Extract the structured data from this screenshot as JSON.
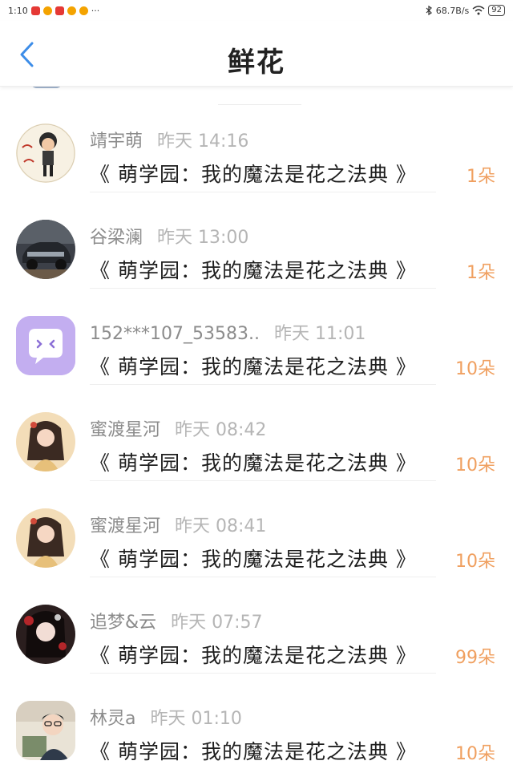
{
  "status_bar": {
    "time": "1:10",
    "dots": "···",
    "network_speed": "68.7B/s",
    "battery": "92"
  },
  "header": {
    "title": "鲜花",
    "back_icon": "chevron-left-icon"
  },
  "colors": {
    "accent_blue": "#3d8de8",
    "count_orange": "#f0a060",
    "time_gray": "#b5b5b5"
  },
  "items": [
    {
      "user": "靖宇萌",
      "time": "昨天 14:16",
      "book": "《 萌学园：我的魔法是花之法典 》",
      "count": "1朵"
    },
    {
      "user": "谷梁澜",
      "time": "昨天 13:00",
      "book": "《 萌学园：我的魔法是花之法典 》",
      "count": "1朵"
    },
    {
      "user": "152***107_53583..",
      "time": "昨天 11:01",
      "book": "《 萌学园：我的魔法是花之法典 》",
      "count": "10朵"
    },
    {
      "user": "蜜渡星河",
      "time": "昨天 08:42",
      "book": "《 萌学园：我的魔法是花之法典 》",
      "count": "10朵"
    },
    {
      "user": "蜜渡星河",
      "time": "昨天 08:41",
      "book": "《 萌学园：我的魔法是花之法典 》",
      "count": "10朵"
    },
    {
      "user": "追梦&云",
      "time": "昨天 07:57",
      "book": "《 萌学园：我的魔法是花之法典 》",
      "count": "99朵"
    },
    {
      "user": "林灵a",
      "time": "昨天 01:10",
      "book": "《 萌学园：我的魔法是花之法典 》",
      "count": "10朵"
    }
  ]
}
